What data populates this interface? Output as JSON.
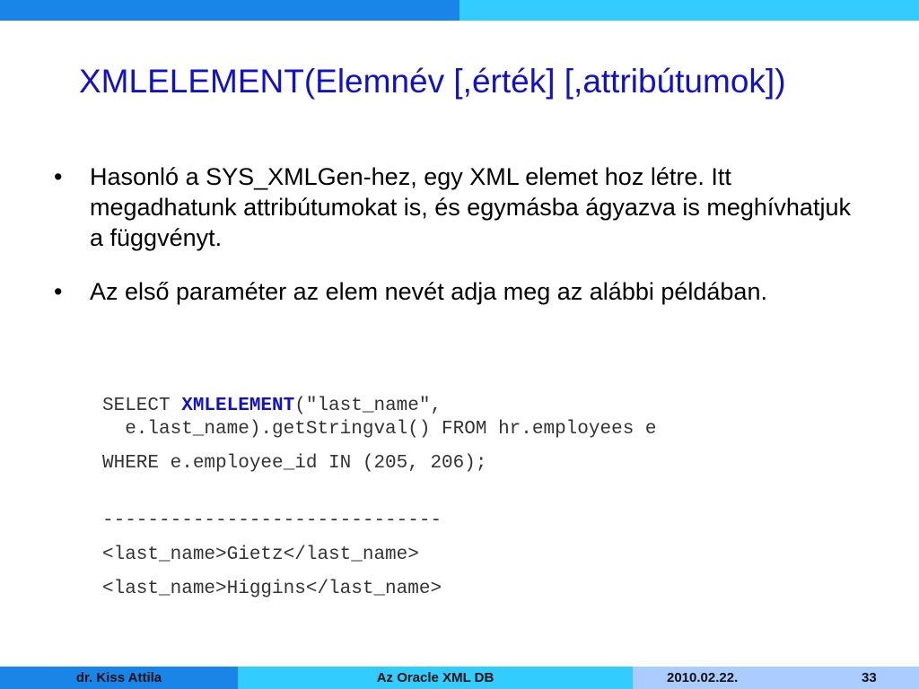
{
  "slide": {
    "title": "XMLELEMENT(Elemnév [,érték] [,attribútumok])",
    "bullets": [
      "Hasonló a SYS_XMLGen-hez, egy XML elemet hoz létre. Itt megadhatunk attribútumokat is, és egymásba ágyazva is meghívhatjuk a függvényt.",
      "Az első paraméter az elem nevét adja meg az alábbi példában."
    ],
    "code": {
      "line1_pre": "SELECT ",
      "line1_kw": "XMLELEMENT",
      "line1_post": "(\"last_name\",",
      "line2": "  e.last_name).getStringval() FROM hr.employees e",
      "line3": "WHERE e.employee_id IN (205, 206);",
      "separator": "------------------------------",
      "result1": "<last_name>Gietz</last_name>",
      "result2": "<last_name>Higgins</last_name>"
    }
  },
  "footer": {
    "author": "dr. Kiss Attila",
    "topic": "Az Oracle XML DB",
    "date": "2010.02.22.",
    "page": "33"
  },
  "colors": {
    "title": "#1111cc",
    "bar_dark": "#1a85e8",
    "bar_light": "#33ccff",
    "footer_right": "#aaccff"
  }
}
